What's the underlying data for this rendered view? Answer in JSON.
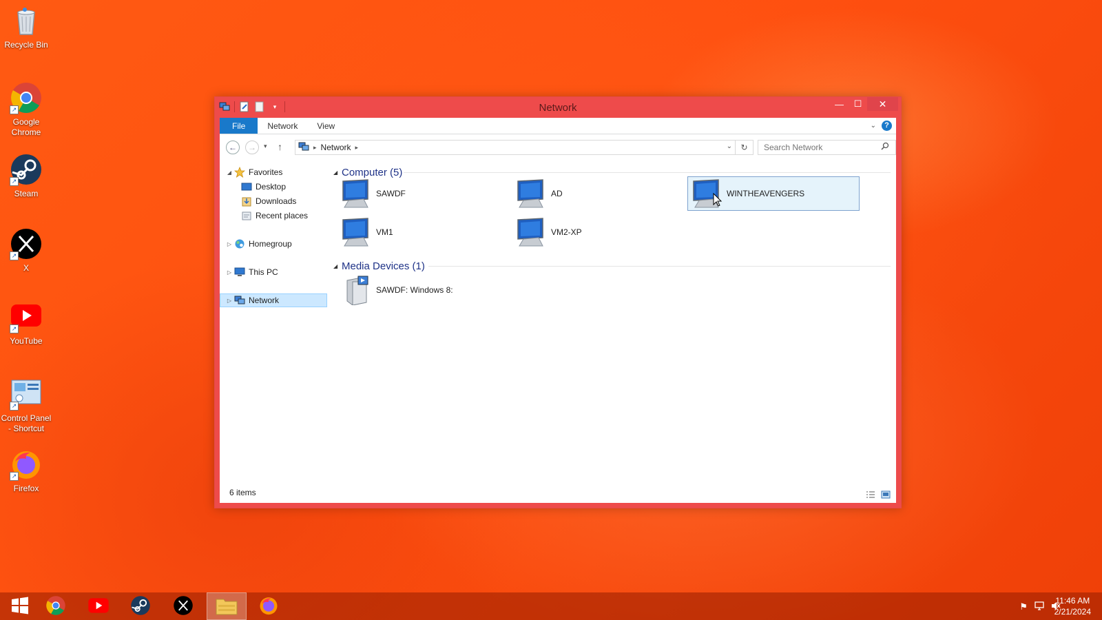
{
  "desktop": {
    "icons": [
      {
        "label": "Recycle Bin",
        "icon": "recycle-bin-icon"
      },
      {
        "label": "Google Chrome",
        "icon": "chrome-icon"
      },
      {
        "label": "Steam",
        "icon": "steam-icon"
      },
      {
        "label": "X",
        "icon": "x-icon"
      },
      {
        "label": "YouTube",
        "icon": "youtube-icon"
      },
      {
        "label": "Control Panel - Shortcut",
        "icon": "control-panel-icon"
      },
      {
        "label": "Firefox",
        "icon": "firefox-icon"
      }
    ]
  },
  "window": {
    "title": "Network",
    "ribbon": {
      "tabs": [
        "File",
        "Network",
        "View"
      ]
    },
    "address": {
      "crumbs": [
        "Network"
      ]
    },
    "search": {
      "placeholder": "Search Network"
    },
    "nav": {
      "favorites": "Favorites",
      "desktop": "Desktop",
      "downloads": "Downloads",
      "recent": "Recent places",
      "homegroup": "Homegroup",
      "this_pc": "This PC",
      "network": "Network"
    },
    "groups": [
      {
        "title": "Computer (5)",
        "items": [
          "SAWDF",
          "AD",
          "WINTHEAVENGERS",
          "VM1",
          "VM2-XP"
        ]
      },
      {
        "title": "Media Devices (1)",
        "items": [
          "SAWDF: Windows 8:"
        ]
      }
    ],
    "selected_item": "WINTHEAVENGERS",
    "status": "6 items"
  },
  "taskbar": {
    "apps": [
      "start-icon",
      "chrome-icon",
      "youtube-icon",
      "steam-icon",
      "x-icon",
      "file-explorer-icon",
      "firefox-icon"
    ],
    "active_app": "file-explorer-icon",
    "time": "11:46 AM",
    "date": "2/21/2024"
  },
  "colors": {
    "accent": "#1979ca",
    "window_frame": "#ee4b4b",
    "group_header": "#1e3287",
    "selection": "#e5f3fb"
  }
}
